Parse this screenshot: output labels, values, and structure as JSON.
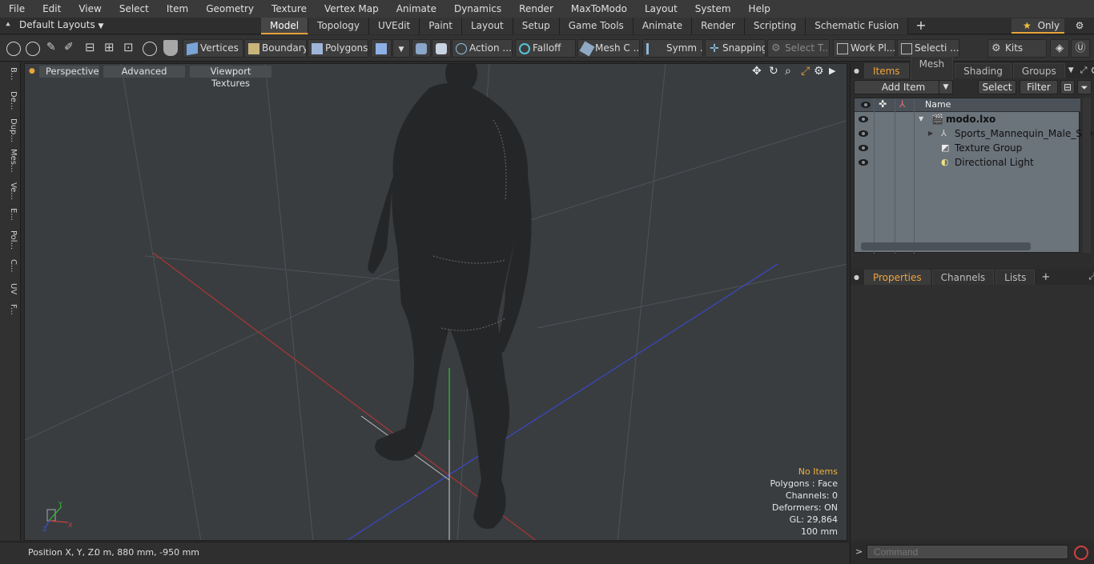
{
  "menubar": [
    "File",
    "Edit",
    "View",
    "Select",
    "Item",
    "Geometry",
    "Texture",
    "Vertex Map",
    "Animate",
    "Dynamics",
    "Render",
    "MaxToModo",
    "Layout",
    "System",
    "Help"
  ],
  "layouts": {
    "label": "Default Layouts"
  },
  "tabs": [
    "Model",
    "Topology",
    "UVEdit",
    "Paint",
    "Layout",
    "Setup",
    "Game Tools",
    "Animate",
    "Render",
    "Scripting",
    "Schematic Fusion"
  ],
  "active_tab": "Model",
  "only_label": "Only",
  "toolbar": {
    "vertices": "Vertices",
    "boundary": "Boundary",
    "polygons": "Polygons",
    "action": "Action",
    "falloff": "Falloff",
    "mesh": "Mesh C ...",
    "symm": "Symm ...",
    "snapping": "Snapping",
    "select_t": "Select T...",
    "workplane": "Work Pl...",
    "selecti": "Selecti ...",
    "kits": "Kits"
  },
  "leftstrip": [
    "B...",
    "De...",
    "Dup...",
    "Mes...",
    "Ve...",
    "E...",
    "Pol...",
    "C...",
    "UV",
    "F..."
  ],
  "viewport": {
    "perspective": "Perspective",
    "advanced": "Advanced",
    "viewport_textures": "Viewport Textures",
    "stats": {
      "no_items": "No Items",
      "polygons": "Polygons : Face",
      "channels": "Channels: 0",
      "deformers": "Deformers: ON",
      "gl": "GL: 29,864",
      "scale": "100 mm"
    },
    "axis": {
      "x": "X",
      "y": "Y",
      "z": "Z"
    }
  },
  "status": {
    "label": "Position X, Y, Z:",
    "value": "0 m, 880 mm, -950 mm"
  },
  "items_panel": {
    "tabs": [
      "Items",
      "Mesh ...",
      "Shading",
      "Groups"
    ],
    "add_item": "Add Item",
    "select": "Select",
    "filter": "Filter",
    "name_header": "Name",
    "rows": [
      {
        "name": "modo.lxo",
        "bold": true
      },
      {
        "name": "Sports_Mannequin_Male_Silver",
        "bold": false
      },
      {
        "name": "Texture Group",
        "bold": false
      },
      {
        "name": "Directional Light",
        "bold": false
      }
    ]
  },
  "props_panel": {
    "tabs": [
      "Properties",
      "Channels",
      "Lists"
    ]
  },
  "command": {
    "placeholder": "Command"
  },
  "colors": {
    "accent": "#e8a33a",
    "viewport_bg": "#393d40",
    "items_bg": "#6b737b"
  }
}
